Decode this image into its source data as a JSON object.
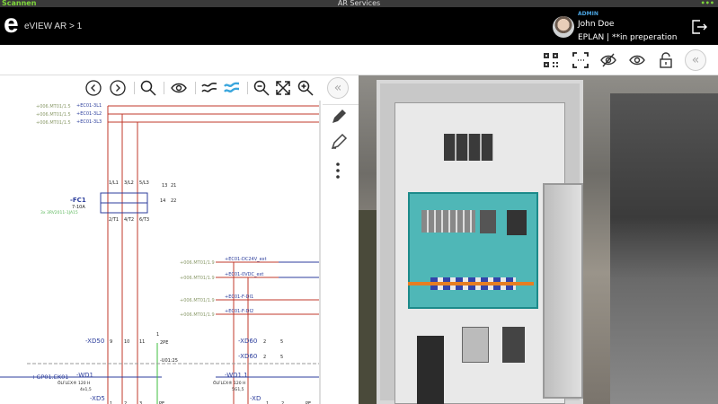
{
  "status_bar": {
    "back": "Scannen",
    "title": "AR Services",
    "battery": "•••"
  },
  "header": {
    "logo": "e",
    "breadcrumb": "eVIEW AR > 1",
    "role": "ADMIN",
    "user": "John Doe",
    "org": "EPLAN | **in preperation"
  },
  "schematic": {
    "refs": [
      "+006.MT01/1.5",
      "+006.MT01/1.5",
      "+006.MT01/1.5"
    ],
    "lines": [
      "+EC01-3L1",
      "+EC01-3L2",
      "+EC01-3L3"
    ],
    "terms_top": [
      "1/L1",
      "3/L2",
      "5/L3",
      "13",
      "21"
    ],
    "terms_bot": [
      "2/T1",
      "4/T2",
      "6/T3",
      "14",
      "22"
    ],
    "device": "-FC1",
    "rating": "7-10A",
    "part": "3x 3RV2011-1JA15",
    "signals": [
      {
        "ref": "+006.MT01/1.9",
        "name": "+EC01-DC24V_ext"
      },
      {
        "ref": "+006.MT01/1.9",
        "name": "+EC01-0VDC_ext"
      },
      {
        "ref": "+006.MT01/1.9",
        "name": "+EC01-F-DI1"
      },
      {
        "ref": "+006.MT01/1.9",
        "name": "+EC01-F-DI2"
      }
    ],
    "xd50": "-XD50",
    "xd50_terms": [
      "9",
      "10",
      "11",
      "1"
    ],
    "pe": "2PE",
    "u01": "-U01:25",
    "xd60": "-XD60",
    "xd60_terms": [
      "2",
      "5"
    ],
    "xd60b": "-XD60",
    "xd60b_terms": [
      "2",
      "5"
    ],
    "gp01": "+GP01.EK01",
    "wd1": "-WD1",
    "wd1_cable": "ÖLFLEX® 120 H",
    "wd1_size": "4x1,5",
    "wd11": "-WD1.1",
    "wd11_cable": "ÖLFLEX® 120 H",
    "wd11_size": "5G1,5",
    "xd5": "-XD5",
    "xd5_terms": [
      "1",
      "2",
      "3",
      "PE"
    ],
    "xd": "-XD",
    "xd_terms": [
      "1",
      "2",
      "PE"
    ]
  },
  "icons": {
    "accent": "#3aa6dd"
  }
}
